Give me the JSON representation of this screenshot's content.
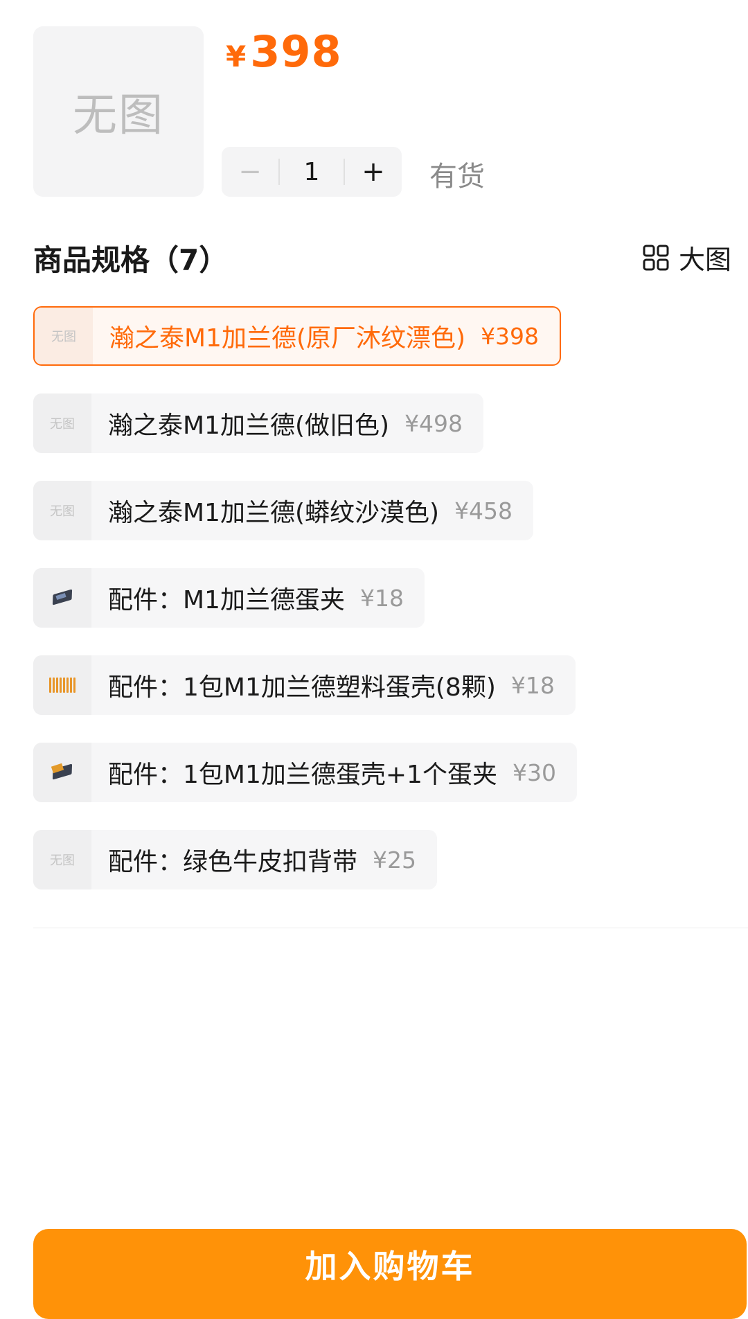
{
  "product": {
    "thumb_placeholder": "无图",
    "price_symbol": "¥",
    "price": "398",
    "quantity": "1",
    "minus_label": "−",
    "plus_label": "+",
    "stock_status": "有货"
  },
  "spec": {
    "title": "商品规格（7）",
    "bigview_label": "大图",
    "options": [
      {
        "thumb": "无图",
        "label": "瀚之泰M1加兰德(原厂沐纹漂色)",
        "price": "¥398",
        "selected": true
      },
      {
        "thumb": "无图",
        "label": "瀚之泰M1加兰德(做旧色)",
        "price": "¥498",
        "selected": false
      },
      {
        "thumb": "无图",
        "label": "瀚之泰M1加兰德(蟒纹沙漠色)",
        "price": "¥458",
        "selected": false
      },
      {
        "thumb": "clip-icon",
        "label": "配件：M1加兰德蛋夹",
        "price": "¥18",
        "selected": false
      },
      {
        "thumb": "shells-icon",
        "label": "配件：1包M1加兰德塑料蛋壳(8颗)",
        "price": "¥18",
        "selected": false
      },
      {
        "thumb": "clip-shell-icon",
        "label": "配件：1包M1加兰德蛋壳+1个蛋夹",
        "price": "¥30",
        "selected": false
      },
      {
        "thumb": "无图",
        "label": "配件：绿色牛皮扣背带",
        "price": "¥25",
        "selected": false
      }
    ]
  },
  "cart": {
    "label": "加入购物车"
  },
  "colors": {
    "accent": "#ff6a0a",
    "cart_button": "#ff9208",
    "option_bg": "#f6f6f7",
    "muted_text": "#9a9a9a"
  }
}
